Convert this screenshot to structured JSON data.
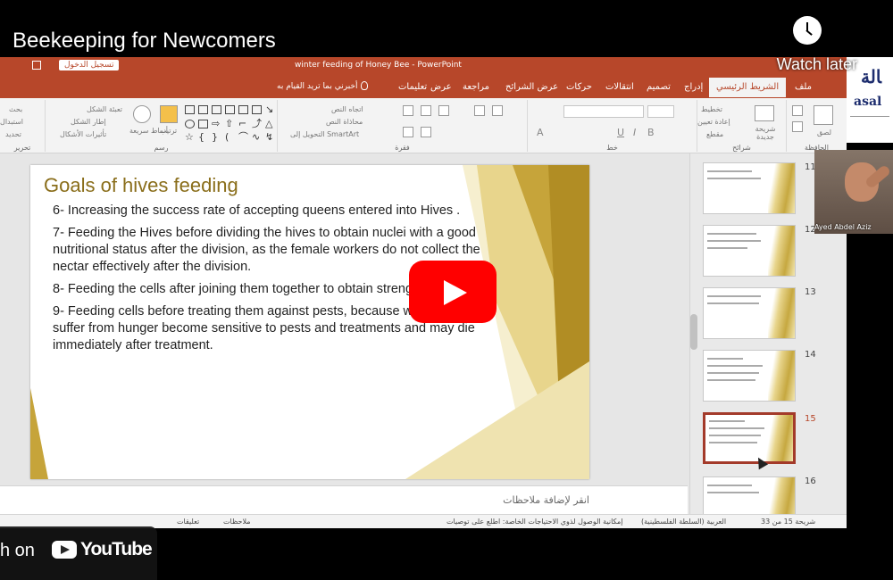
{
  "video": {
    "title": "Beekeeping for Newcomers",
    "watch_later": "Watch later",
    "watch_on": "h on",
    "youtube_word": "YouTube"
  },
  "window": {
    "title": "winter feeding of Honey Bee  -  PowerPoint",
    "login": "تسجيل الدخول"
  },
  "tabs": [
    {
      "label": "ملف"
    },
    {
      "label": "الشريط الرئيسي",
      "active": true
    },
    {
      "label": "إدراج"
    },
    {
      "label": "تصميم"
    },
    {
      "label": "انتقالات"
    },
    {
      "label": "حركات"
    },
    {
      "label": "عرض الشرائح"
    },
    {
      "label": "مراجعة"
    },
    {
      "label": "عرض"
    },
    {
      "label": "تعليمات"
    }
  ],
  "tell_me": "أخبرني بما تريد القيام به",
  "ribbon": {
    "groups": {
      "clipboard": "الحافظة",
      "slides": "شرائح",
      "font": "خط",
      "paragraph": "فقرة",
      "drawing": "رسم",
      "editing": "تحرير"
    },
    "paste": "لصق",
    "new_slide": "شريحة جديدة",
    "layout": "تخطيط",
    "reset": "إعادة تعيين",
    "section": "مقطع",
    "text_direction": "اتجاه النص",
    "align_text": "محاذاة النص",
    "convert_smartart": "التحويل إلى SmartArt",
    "arrange": "ترتيب",
    "quick_styles": "أنماط سريعة",
    "shape_fill": "تعبئة الشكل",
    "shape_outline": "إطار الشكل",
    "shape_effects": "تأثيرات الأشكال",
    "find": "بحث",
    "replace": "استبدال",
    "select": "تحديد"
  },
  "slide": {
    "title": "Goals of hives feeding",
    "paragraphs": [
      "6- Increasing the success rate of accepting queens entered into Hives .",
      " 7- Feeding the Hives  before dividing the hives  to obtain nuclei with a good nutritional status after the division, as the female workers do not collect the nectar effectively after the division.",
      "8- Feeding the cells after joining them together to obtain strength after joining.",
      "9- Feeding cells before treating them against pests, because workers who suffer from hunger become sensitive to pests and treatments and may die immediately after treatment."
    ]
  },
  "notes_placeholder": "انقر لإضافة ملاحظات",
  "thumbnails": [
    {
      "num": "11"
    },
    {
      "num": "12"
    },
    {
      "num": "13"
    },
    {
      "num": "14"
    },
    {
      "num": "15",
      "active": true
    },
    {
      "num": "16"
    }
  ],
  "status": {
    "slide_count": "شريحة 15 من 33",
    "language": "العربية (السلطة الفلسطينية)",
    "accessibility": "إمكانية الوصول لذوي الاحتياجات الخاصة: اطلع على توصيات",
    "notes": "ملاحظات",
    "comments": "تعليقات"
  },
  "webcam": {
    "name": "Ayed Abdel Aziz"
  },
  "logo": {
    "text": "asal"
  },
  "colors": {
    "accent": "#b7472a",
    "gold": "#8a6e1b",
    "youtube_red": "#ff0000"
  }
}
